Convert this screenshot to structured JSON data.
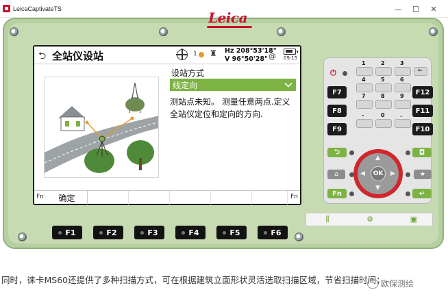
{
  "window": {
    "title": "LeicaCaptivateTS",
    "min": "—",
    "max": "☐",
    "close": "✕"
  },
  "device": {
    "brand": "Leica"
  },
  "screen": {
    "title": "全站仪设站",
    "status": {
      "face": "1",
      "hz": "Hz 208°53'18\"",
      "v": "V   96°50'28\"",
      "time": "09:15"
    },
    "field_label": "设站方式",
    "method_value": "线定向",
    "description": "测站点未知。 测量任意两点.定义全站仪定位和定向的方向.",
    "softkeys": {
      "fn_left": "Fn",
      "ok": "确定",
      "fn_right": "Fn"
    }
  },
  "keypad": {
    "f_side": [
      "F7",
      "F8",
      "F9"
    ],
    "f_side_right": [
      "F12",
      "F11",
      "F10"
    ],
    "numbers": [
      "1",
      "2",
      "3",
      "4",
      "5",
      "6",
      "7",
      "8",
      "9",
      "0",
      "-",
      "."
    ],
    "ok": "OK",
    "fn": "Fn"
  },
  "function_keys": [
    "F1",
    "F2",
    "F3",
    "F4",
    "F5",
    "F6"
  ],
  "caption": "同时，徕卡MS60还提供了多种扫描方式，可在根据建筑立面形状灵活选取扫描区域，节省扫描时间；",
  "watermark": "欧保测绘"
}
